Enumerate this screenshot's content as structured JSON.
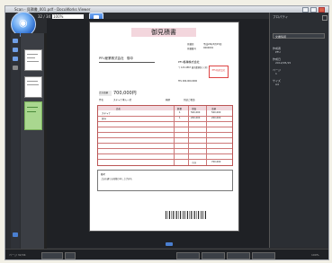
{
  "window": {
    "title": "Scan - 見積書_001.pdf - DocuWorks Viewer"
  },
  "toolbar": {
    "page_text": "32 / 34",
    "zoom_value": "100%"
  },
  "document": {
    "title": "御見積書",
    "date_label": "見積日",
    "date_value": "平成24年5月15日",
    "number_label": "見積番号",
    "number_value": "0000001",
    "recipient": "PFU産業株式会社　御中",
    "company_name": "PFU各種株式会社",
    "address": "〒 123-4567 東京都港区○○町",
    "phone": "TEL 000-000-0000",
    "stamp": "PFU株式会社",
    "total_label": "合計金額",
    "total_value": "700,000円",
    "subject_label": "件名",
    "subject_value": "スキャナ導入一式",
    "delivery_label": "納期",
    "delivery_value": "別途ご相談",
    "table_headers": [
      "品名",
      "数量",
      "単価",
      "金額"
    ],
    "items": [
      {
        "name": "スキャナ",
        "qty": "1",
        "price": "500,000",
        "amount": "500,000"
      },
      {
        "name": "保守",
        "qty": "1",
        "price": "200,000",
        "amount": "200,000"
      }
    ],
    "subtotal_label": "小計",
    "subtotal_value": "700,000",
    "notes_label": "備考",
    "notes_text": "上記の通りお見積り申し上げます。"
  },
  "side_panel": {
    "header": "プロパティ",
    "dropdown": "文書情報",
    "fields": [
      {
        "label": "作成者",
        "value": "PFU"
      },
      {
        "label": "作成日",
        "value": "2012/05/15"
      },
      {
        "label": "ページ",
        "value": "1"
      },
      {
        "label": "サイズ",
        "value": "A4"
      }
    ]
  },
  "status": {
    "left": "ページ 32/34",
    "right": "100%"
  },
  "colors": {
    "accent": "#2f6bd0",
    "thumb_green": "#a9d78f",
    "page_rule": "#c77"
  }
}
